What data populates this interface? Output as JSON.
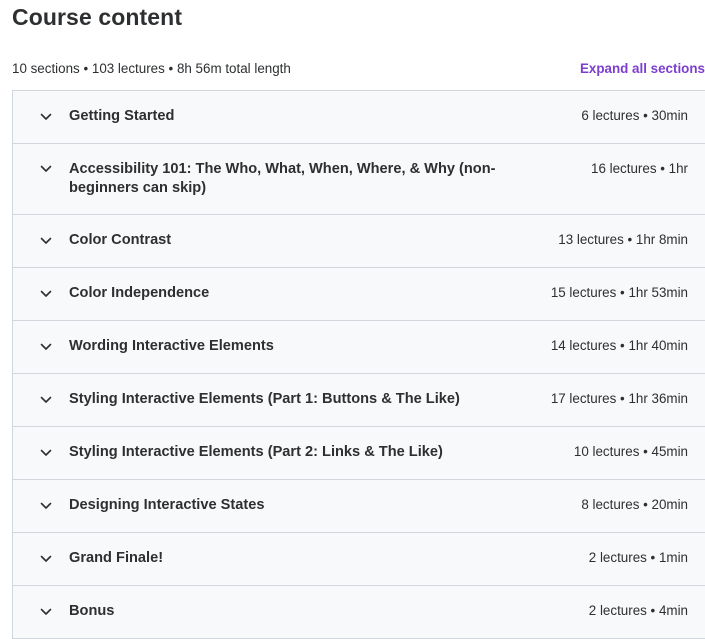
{
  "header": {
    "title": "Course content",
    "summary": "10 sections • 103 lectures • 8h 56m total length",
    "expand_all_label": "Expand all sections"
  },
  "sections": [
    {
      "title": "Getting Started",
      "meta": "6 lectures • 30min"
    },
    {
      "title": "Accessibility 101: The Who, What, When, Where, & Why (non-beginners can skip)",
      "meta": "16 lectures • 1hr"
    },
    {
      "title": "Color Contrast",
      "meta": "13 lectures • 1hr 8min"
    },
    {
      "title": "Color Independence",
      "meta": "15 lectures • 1hr 53min"
    },
    {
      "title": "Wording Interactive Elements",
      "meta": "14 lectures • 1hr 40min"
    },
    {
      "title": "Styling Interactive Elements (Part 1: Buttons & The Like)",
      "meta": "17 lectures • 1hr 36min"
    },
    {
      "title": "Styling Interactive Elements (Part 2: Links & The Like)",
      "meta": "10 lectures • 45min"
    },
    {
      "title": "Designing Interactive States",
      "meta": "8 lectures • 20min"
    },
    {
      "title": "Grand Finale!",
      "meta": "2 lectures • 1min"
    },
    {
      "title": "Bonus",
      "meta": "2 lectures • 4min"
    }
  ],
  "colors": {
    "accent": "#7c3ecf",
    "text": "#2d2f31",
    "section_bg": "#f7f9fa",
    "border": "#d1d7dc"
  },
  "icons": {
    "section_toggle": "chevron-down-icon"
  }
}
